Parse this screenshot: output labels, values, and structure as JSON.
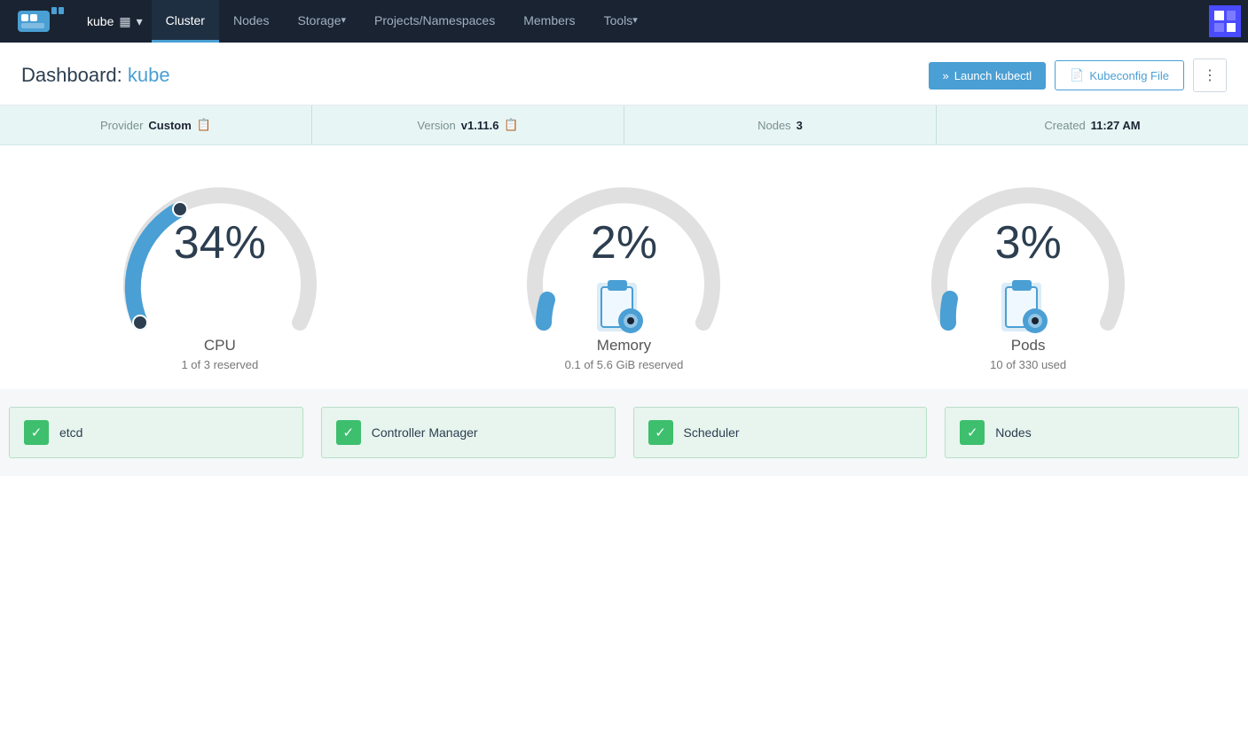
{
  "navbar": {
    "brand": "kube",
    "cluster_icon": "server-icon",
    "arrow_icon": "chevron-down-icon",
    "nav_items": [
      {
        "label": "Cluster",
        "active": true,
        "has_arrow": false
      },
      {
        "label": "Nodes",
        "active": false,
        "has_arrow": false
      },
      {
        "label": "Storage",
        "active": false,
        "has_arrow": true
      },
      {
        "label": "Projects/Namespaces",
        "active": false,
        "has_arrow": false
      },
      {
        "label": "Members",
        "active": false,
        "has_arrow": false
      },
      {
        "label": "Tools",
        "active": false,
        "has_arrow": true
      }
    ]
  },
  "header": {
    "title_prefix": "Dashboard: ",
    "title_value": "kube",
    "launch_kubectl_label": "Launch kubectl",
    "kubeconfig_label": "Kubeconfig File",
    "more_label": "⋮"
  },
  "info_bar": {
    "provider_label": "Provider",
    "provider_value": "Custom",
    "version_label": "Version",
    "version_value": "v1.11.6",
    "nodes_label": "Nodes",
    "nodes_value": "3",
    "created_label": "Created",
    "created_value": "11:27 AM"
  },
  "gauges": [
    {
      "id": "cpu",
      "percent": "34%",
      "title": "CPU",
      "subtitle": "1 of 3 reserved",
      "value": 34,
      "color": "#4a9fd4",
      "bg_color": "#e0e0e0"
    },
    {
      "id": "memory",
      "percent": "2%",
      "title": "Memory",
      "subtitle": "0.1 of 5.6 GiB reserved",
      "value": 2,
      "color": "#4a9fd4",
      "bg_color": "#e0e0e0"
    },
    {
      "id": "pods",
      "percent": "3%",
      "title": "Pods",
      "subtitle": "10 of 330 used",
      "value": 3,
      "color": "#4a9fd4",
      "bg_color": "#e0e0e0"
    }
  ],
  "status_cards": [
    {
      "label": "etcd",
      "status": "ok"
    },
    {
      "label": "Controller Manager",
      "status": "ok"
    },
    {
      "label": "Scheduler",
      "status": "ok"
    },
    {
      "label": "Nodes",
      "status": "ok"
    }
  ]
}
